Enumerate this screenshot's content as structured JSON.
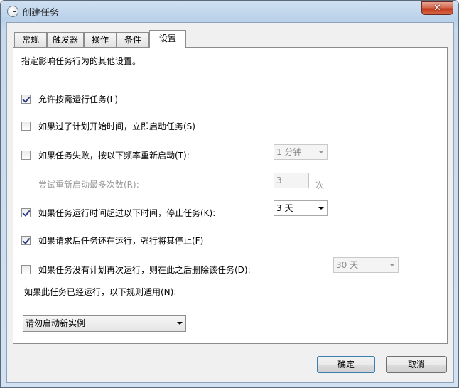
{
  "window": {
    "title": "创建任务",
    "close_glyph": "✕"
  },
  "tabs": [
    {
      "label": "常规"
    },
    {
      "label": "触发器"
    },
    {
      "label": "操作"
    },
    {
      "label": "条件"
    },
    {
      "label": "设置",
      "active": true
    }
  ],
  "settings": {
    "description": "指定影响任务行为的其他设置。",
    "allow_on_demand": {
      "label": "允许按需运行任务(L)",
      "checked": true
    },
    "start_when_missed": {
      "label": "如果过了计划开始时间，立即启动任务(S)",
      "checked": false
    },
    "restart_on_failure": {
      "label": "如果任务失败，按以下频率重新启动(T):",
      "checked": false,
      "interval_value": "1 分钟"
    },
    "restart_attempts": {
      "label": "尝试重新启动最多次数(R):",
      "value": "3",
      "unit": "次"
    },
    "stop_if_runs_longer": {
      "label": "如果任务运行时间超过以下时间，停止任务(K):",
      "checked": true,
      "duration_value": "3 天"
    },
    "force_stop": {
      "label": "如果请求后任务还在运行，强行将其停止(F)",
      "checked": true
    },
    "delete_if_not_scheduled": {
      "label": "如果任务没有计划再次运行，则在此之后删除该任务(D):",
      "checked": false,
      "after_value": "30 天"
    },
    "if_running_rule": {
      "label": "如果此任务已经运行，以下规则适用(N):",
      "value": "请勿启动新实例"
    }
  },
  "buttons": {
    "ok": "确定",
    "cancel": "取消"
  }
}
